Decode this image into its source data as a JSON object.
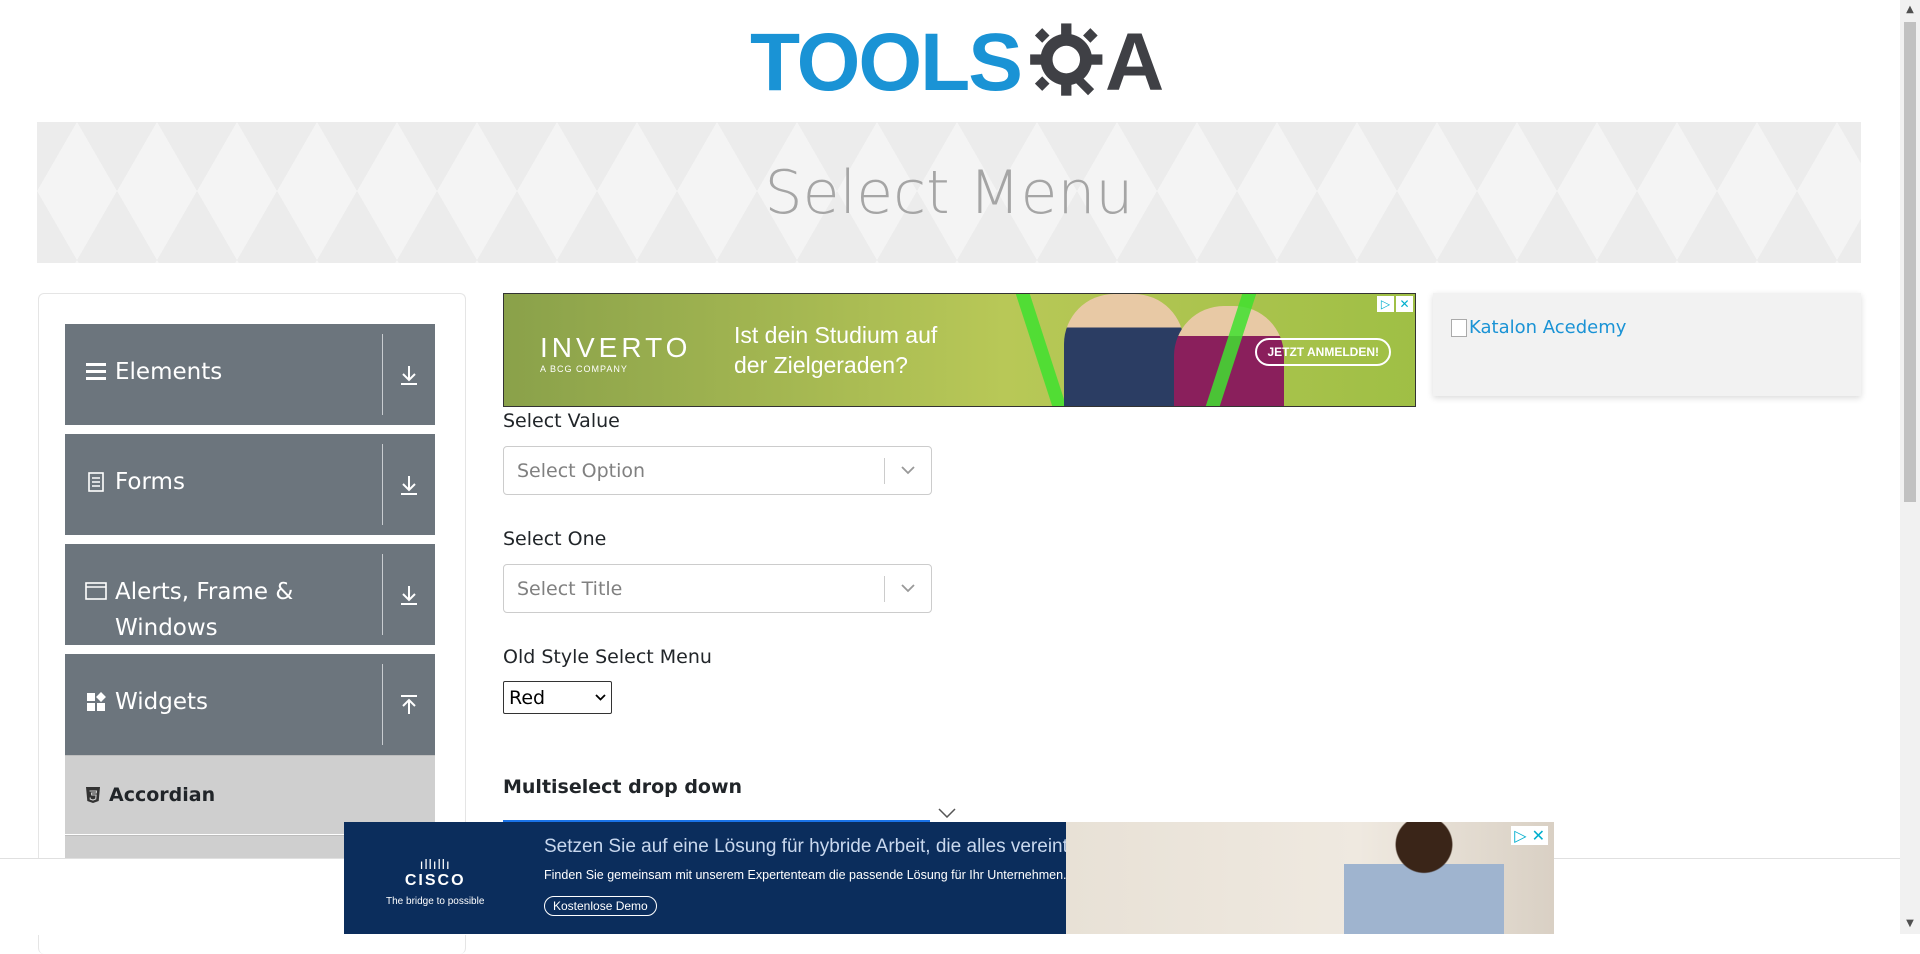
{
  "header": {
    "logo_tools": "TOOLS",
    "logo_a": "A",
    "logo_alt": "TOOLSQA"
  },
  "page": {
    "title": "Select Menu"
  },
  "sidebar": {
    "groups": [
      {
        "label": "Elements",
        "icon": "hamburger-icon",
        "toggle": "download-icon"
      },
      {
        "label": "Forms",
        "icon": "document-icon",
        "toggle": "download-icon"
      },
      {
        "label": "Alerts, Frame & Windows",
        "icon": "window-icon",
        "toggle": "download-icon"
      },
      {
        "label": "Widgets",
        "icon": "widgets-icon",
        "toggle": "upload-icon",
        "expanded": true
      }
    ],
    "items": [
      {
        "label": "Accordian",
        "icon": "html5-icon"
      }
    ]
  },
  "ads": {
    "top": {
      "brand": "INVERTO",
      "brand_sub": "A BCG COMPANY",
      "headline_1": "Ist dein Studium auf",
      "headline_2": "der Zielgeraden?",
      "cta": "JETZT ANMELDEN!"
    },
    "side": {
      "alt": "Katalon Acedemy"
    },
    "bottom": {
      "brand": "CISCO",
      "brand_tag": "The bridge to possible",
      "title": "Setzen Sie auf eine Lösung für hybride Arbeit, die alles vereint",
      "subtitle": "Finden Sie gemeinsam mit unserem Expertenteam die passende Lösung für Ihr Unternehmen.",
      "cta": "Kostenlose Demo"
    }
  },
  "form": {
    "select_value": {
      "label": "Select Value",
      "placeholder": "Select Option"
    },
    "select_one": {
      "label": "Select One",
      "placeholder": "Select Title"
    },
    "old_style": {
      "label": "Old Style Select Menu",
      "value": "Red"
    },
    "multiselect": {
      "label": "Multiselect drop down"
    }
  },
  "colors": {
    "brand_blue": "#1a93d5",
    "sidebar_group": "#6c757d",
    "sidebar_item": "#cfcfcf",
    "ad_navy": "#0b2d5c"
  }
}
